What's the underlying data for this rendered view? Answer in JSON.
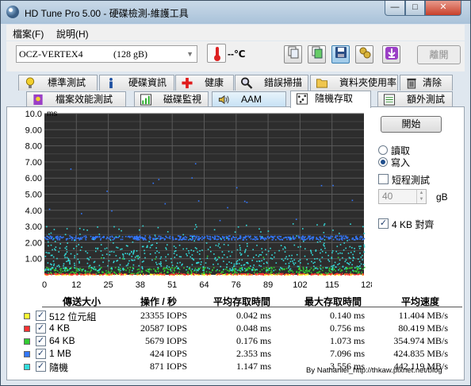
{
  "window": {
    "title": "HD Tune Pro  5.00 - 硬碟檢測-維護工具",
    "minimize": "—",
    "maximize": "□",
    "close": "✕"
  },
  "menu": [
    {
      "label": "檔案(F)"
    },
    {
      "label": "說明(H)"
    }
  ],
  "toolbar": {
    "drive_name": "OCZ-VERTEX4",
    "drive_size": "(128 gB)",
    "temperature": "--℃",
    "exit_label": "離開",
    "buttons": [
      "copy-info-icon",
      "copy-screenshot-icon",
      "save-icon",
      "options-icon",
      "download-icon"
    ]
  },
  "tabs_row1": [
    {
      "label": "標準測試",
      "icon": "lightbulb-icon"
    },
    {
      "label": "硬碟資訊",
      "icon": "info-icon"
    },
    {
      "label": "健康",
      "icon": "health-cross-icon"
    },
    {
      "label": "錯誤掃描",
      "icon": "magnifier-icon"
    },
    {
      "label": "資料夾使用率",
      "icon": "folder-icon"
    },
    {
      "label": "清除",
      "icon": "trash-icon"
    }
  ],
  "tabs_row2": [
    {
      "label": "檔案效能測試",
      "icon": "file-benchmark-icon"
    },
    {
      "label": "磁碟監視",
      "icon": "disk-monitor-icon"
    },
    {
      "label": "AAM",
      "icon": "speaker-icon"
    },
    {
      "label": "隨機存取",
      "icon": "random-access-icon"
    },
    {
      "label": "額外測試",
      "icon": "extra-tests-icon"
    }
  ],
  "selected_tab": "隨機存取",
  "side_panel": {
    "start_label": "開始",
    "read_label": "讀取",
    "write_label": "寫入",
    "mode_selected": "寫入",
    "short_test_label": "短程測試",
    "short_test_checked": false,
    "spin_value": "40",
    "spin_unit": "gB",
    "align_label": "4 KB 對齊",
    "align_checked": true
  },
  "chart_data": {
    "type": "scatter",
    "ylabel": "ms",
    "y_ticks": [
      "10.0",
      "9.00",
      "8.00",
      "7.00",
      "6.00",
      "5.00",
      "4.00",
      "3.00",
      "2.00",
      "1.00"
    ],
    "x_ticks": [
      "0",
      "12",
      "25",
      "38",
      "51",
      "64",
      "76",
      "89",
      "102",
      "115",
      "128gB"
    ],
    "ylim": [
      0,
      10
    ],
    "xlim": [
      0,
      128
    ],
    "grid": true,
    "background": "#2d2d2d",
    "series": [
      {
        "name": "512 位元組",
        "color": "#ffff33",
        "band": [
          0.02,
          0.08
        ]
      },
      {
        "name": "4 KB",
        "color": "#ff3333",
        "band": [
          0.03,
          0.12
        ]
      },
      {
        "name": "64 KB",
        "color": "#33cc33",
        "band": [
          0.1,
          0.5
        ]
      },
      {
        "name": "1 MB",
        "color": "#3377ff",
        "band": [
          2.2,
          2.45
        ]
      },
      {
        "name": "隨機",
        "color": "#33dddd",
        "band": [
          0.3,
          3.2
        ]
      }
    ]
  },
  "stats": {
    "headers": [
      "傳送大小",
      "操作 / 秒",
      "平均存取時間",
      "最大存取時間",
      "平均速度"
    ],
    "rows": [
      {
        "color": "#ffff33",
        "label": "512 位元組",
        "iops": "23355 IOPS",
        "avg": "0.042 ms",
        "max": "0.140 ms",
        "speed": "11.404 MB/s"
      },
      {
        "color": "#ff3333",
        "label": "4 KB",
        "iops": "20587 IOPS",
        "avg": "0.048 ms",
        "max": "0.756 ms",
        "speed": "80.419 MB/s"
      },
      {
        "color": "#33cc33",
        "label": "64 KB",
        "iops": "5679 IOPS",
        "avg": "0.176 ms",
        "max": "1.073 ms",
        "speed": "354.974 MB/s"
      },
      {
        "color": "#3377ff",
        "label": "1 MB",
        "iops": "424 IOPS",
        "avg": "2.353 ms",
        "max": "7.096 ms",
        "speed": "424.835 MB/s"
      },
      {
        "color": "#33dddd",
        "label": "隨機",
        "iops": "871 IOPS",
        "avg": "1.147 ms",
        "max": "3.556 ms",
        "speed": "442.119 MB/s"
      }
    ]
  },
  "credit": "By Nathaniel_http://thkaw.pixnet.net/blog"
}
